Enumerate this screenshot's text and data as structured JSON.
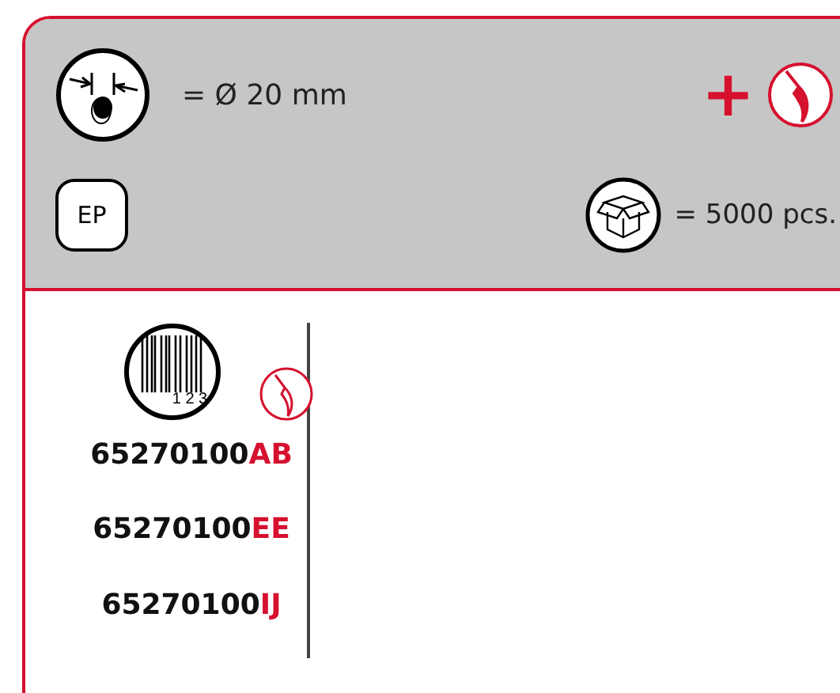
{
  "header": {
    "diameter": "= Ø 20 mm",
    "plus": "+",
    "material": "EP",
    "packaging": "= 5000 pcs."
  },
  "barcode_digits": "1 2 3",
  "codes": [
    {
      "base": "65270100",
      "suffix": "AB"
    },
    {
      "base": "65270100",
      "suffix": "EE"
    },
    {
      "base": "65270100",
      "suffix": "IJ"
    }
  ]
}
